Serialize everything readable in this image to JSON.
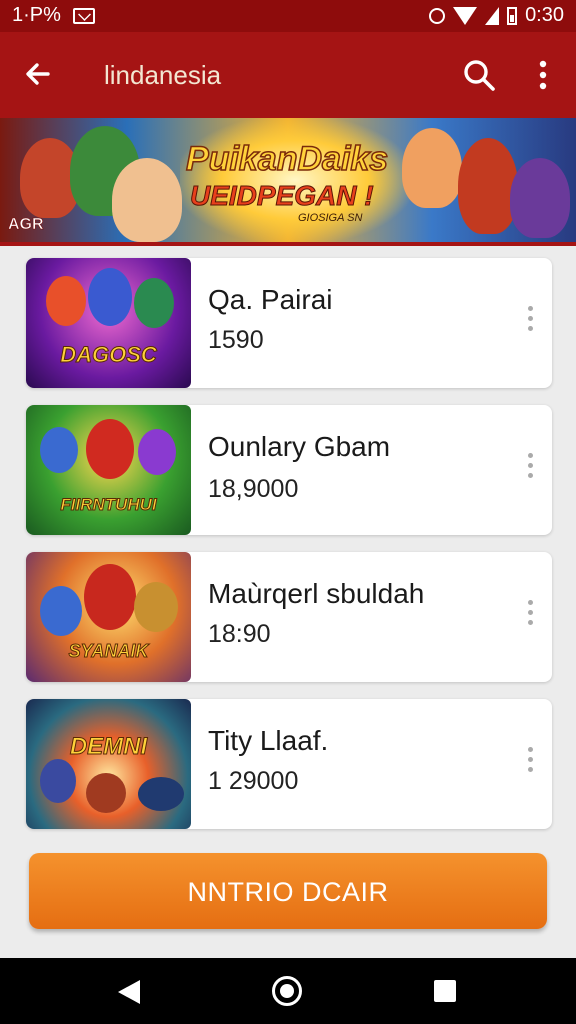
{
  "status_bar": {
    "left_text": "1·P%",
    "time": "0:30"
  },
  "app_bar": {
    "title": "lindanesia",
    "back_icon": "arrow-left-icon",
    "search_icon": "search-icon",
    "more_icon": "more-vert-icon"
  },
  "banner": {
    "headline": "PuikanDaiks",
    "subhead": "UEIDPEGAN !",
    "tagline": "GIOSIGA SN",
    "logo": "AGR"
  },
  "items": [
    {
      "name": "Qa. Pairai",
      "price": "1590",
      "thumb_title": "DAGOSC"
    },
    {
      "name": "Ounlary Gbam",
      "price": "18,9000",
      "thumb_title": "FIIRNTUHUI"
    },
    {
      "name": "Maùrqerl sbuldah",
      "price": "18:90",
      "thumb_title": "SYANAIK"
    },
    {
      "name": "Tity Llaaf.",
      "price": "1 29000",
      "thumb_title": "DEMNI"
    }
  ],
  "cta": {
    "label": "NNTRIO DCAIR"
  },
  "colors": {
    "status_bar": "#8e0c0c",
    "app_bar": "#a51414",
    "cta": "#f0821f",
    "nav_bar": "#000000"
  }
}
